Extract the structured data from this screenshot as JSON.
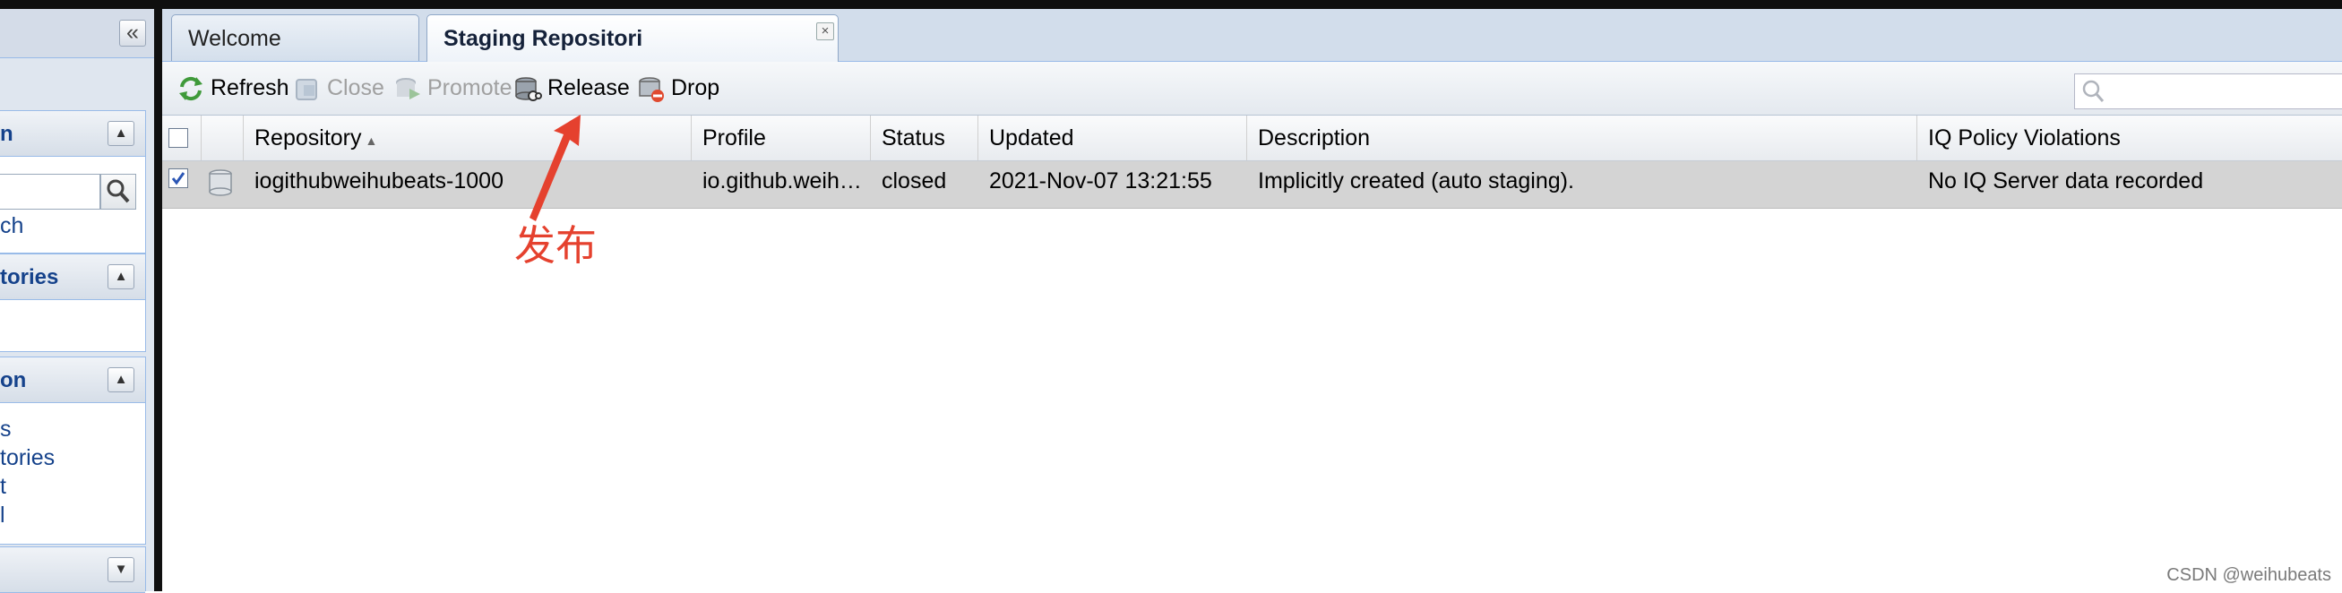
{
  "sidebar": {
    "collapse_glyph": "«",
    "panels": [
      {
        "title": "n",
        "tool_glyph": "▲",
        "link": "ch"
      },
      {
        "title": "tories",
        "tool_glyph": "▲"
      },
      {
        "title": "on",
        "tool_glyph": "▲",
        "links": [
          "s",
          "tories",
          "t",
          "l"
        ]
      },
      {
        "tool_glyph": "▼"
      }
    ]
  },
  "tabs": [
    {
      "label": "Welcome",
      "active": false
    },
    {
      "label": "Staging Repositori",
      "active": true,
      "close_glyph": "×"
    }
  ],
  "toolbar": {
    "buttons": [
      {
        "label": "Refresh",
        "icon": "refresh-icon",
        "disabled": false
      },
      {
        "label": "Close",
        "icon": "close-repo-icon",
        "disabled": true
      },
      {
        "label": "Promote",
        "icon": "promote-icon",
        "disabled": true
      },
      {
        "label": "Release",
        "icon": "release-icon",
        "disabled": false
      },
      {
        "label": "Drop",
        "icon": "drop-icon",
        "disabled": false
      }
    ],
    "search_icon": "search-icon"
  },
  "grid": {
    "columns": [
      "Repository",
      "Profile",
      "Status",
      "Updated",
      "Description",
      "IQ Policy Violations"
    ],
    "sort_glyph": "▲",
    "rows": [
      {
        "checked": true,
        "repository": "iogithubweihubeats-1000",
        "profile": "io.github.weih…",
        "status": "closed",
        "updated": "2021-Nov-07 13:21:55",
        "description": "Implicitly created (auto staging).",
        "iq": "No IQ Server data recorded"
      }
    ]
  },
  "annotation": {
    "text": "发布",
    "color": "#e5412e"
  },
  "watermark": "CSDN @weihubeats",
  "colors": {
    "link": "#15428b",
    "selected_row": "#d4d4d4",
    "annotation": "#e5412e"
  }
}
